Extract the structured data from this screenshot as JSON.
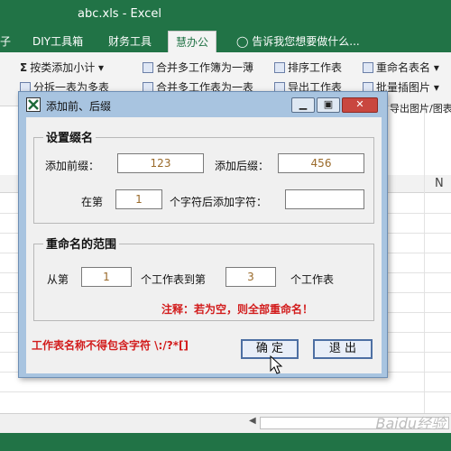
{
  "excel": {
    "title": "abc.xls - Excel",
    "tabs": [
      {
        "label": "子"
      },
      {
        "label": "DIY工具箱"
      },
      {
        "label": "财务工具"
      },
      {
        "label": "慧办公"
      }
    ],
    "tell_me": "告诉我您想要做什么...",
    "ribbon": {
      "btn_batch_subtotal": "按类添加小计",
      "btn_split_table": "分拆一表为多表",
      "btn_merge_workbooks": "合并多工作簿为一薄",
      "btn_merge_sheets": "合并多工作表为一表",
      "btn_sort_sheets": "排序工作表",
      "btn_export_sheets": "导出工作表",
      "btn_rename_sheets": "重命名表名",
      "btn_batch_insert_images": "批量插图片",
      "btn_export_images": "导出图片/图表"
    },
    "column_n": "N"
  },
  "dialog": {
    "title": "添加前、后缀",
    "group_suffix": {
      "title": "设置缀名",
      "prefix_label": "添加前缀：",
      "prefix_value": "123",
      "suffix_label": "添加后缀：",
      "suffix_value": "456",
      "at_label": "在第",
      "at_value": "1",
      "char_label": "个字符后添加字符：",
      "char_value": ""
    },
    "group_range": {
      "title": "重命名的范围",
      "from_label": "从第",
      "from_value": "1",
      "to_label": "个工作表到第",
      "to_value": "3",
      "end_label": "个工作表"
    },
    "note_empty": "注释：若为空，则全部重命名！",
    "note_invalid": "工作表名称不得包含字符 \\:/?*[]",
    "ok_label": "确 定",
    "exit_label": "退 出"
  },
  "watermark": "Baidu经验"
}
